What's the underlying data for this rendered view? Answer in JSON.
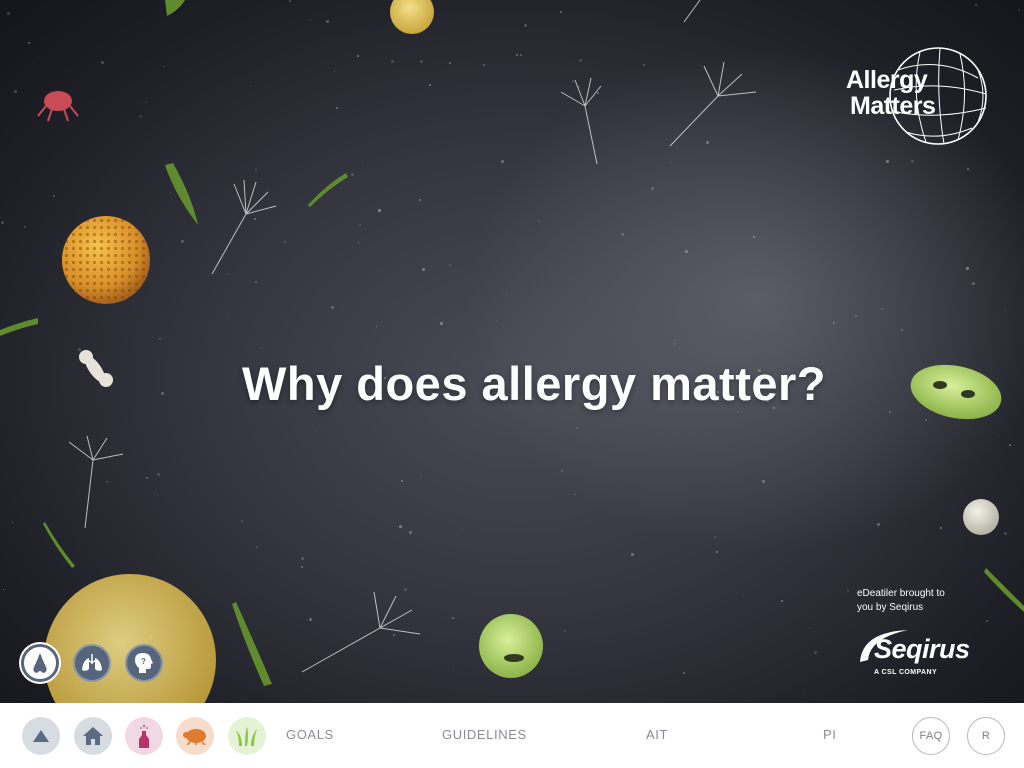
{
  "headline": "Why does allergy matter?",
  "brand": {
    "line1": "Allergy",
    "line2": "Matters"
  },
  "credit": {
    "line1": "eDeatiler brought to",
    "line2": "you by Seqirus"
  },
  "sponsor": {
    "name": "Seqirus",
    "tagline": "A CSL COMPANY"
  },
  "side_buttons": [
    {
      "icon": "nose-icon",
      "active": true
    },
    {
      "icon": "lungs-icon",
      "active": false
    },
    {
      "icon": "head-question-icon",
      "active": false
    }
  ],
  "nav": {
    "icons": [
      {
        "icon": "up-arrow-icon",
        "bg": "#d7dbe2"
      },
      {
        "icon": "home-icon",
        "bg": "#d7dbe2"
      },
      {
        "icon": "pollen-bottle-icon",
        "bg": "#f1d9e4"
      },
      {
        "icon": "dust-mite-icon",
        "bg": "#f6dccd"
      },
      {
        "icon": "grass-icon",
        "bg": "#e6f2d6"
      }
    ],
    "links": [
      "GOALS",
      "GUIDELINES",
      "AIT",
      "PI"
    ],
    "faq": "FAQ",
    "r": "R"
  },
  "colors": {
    "nav_icon": "#5b6b80",
    "accent_pink": "#b8336a",
    "accent_orange": "#e07a2e",
    "accent_green": "#8cc63f"
  }
}
